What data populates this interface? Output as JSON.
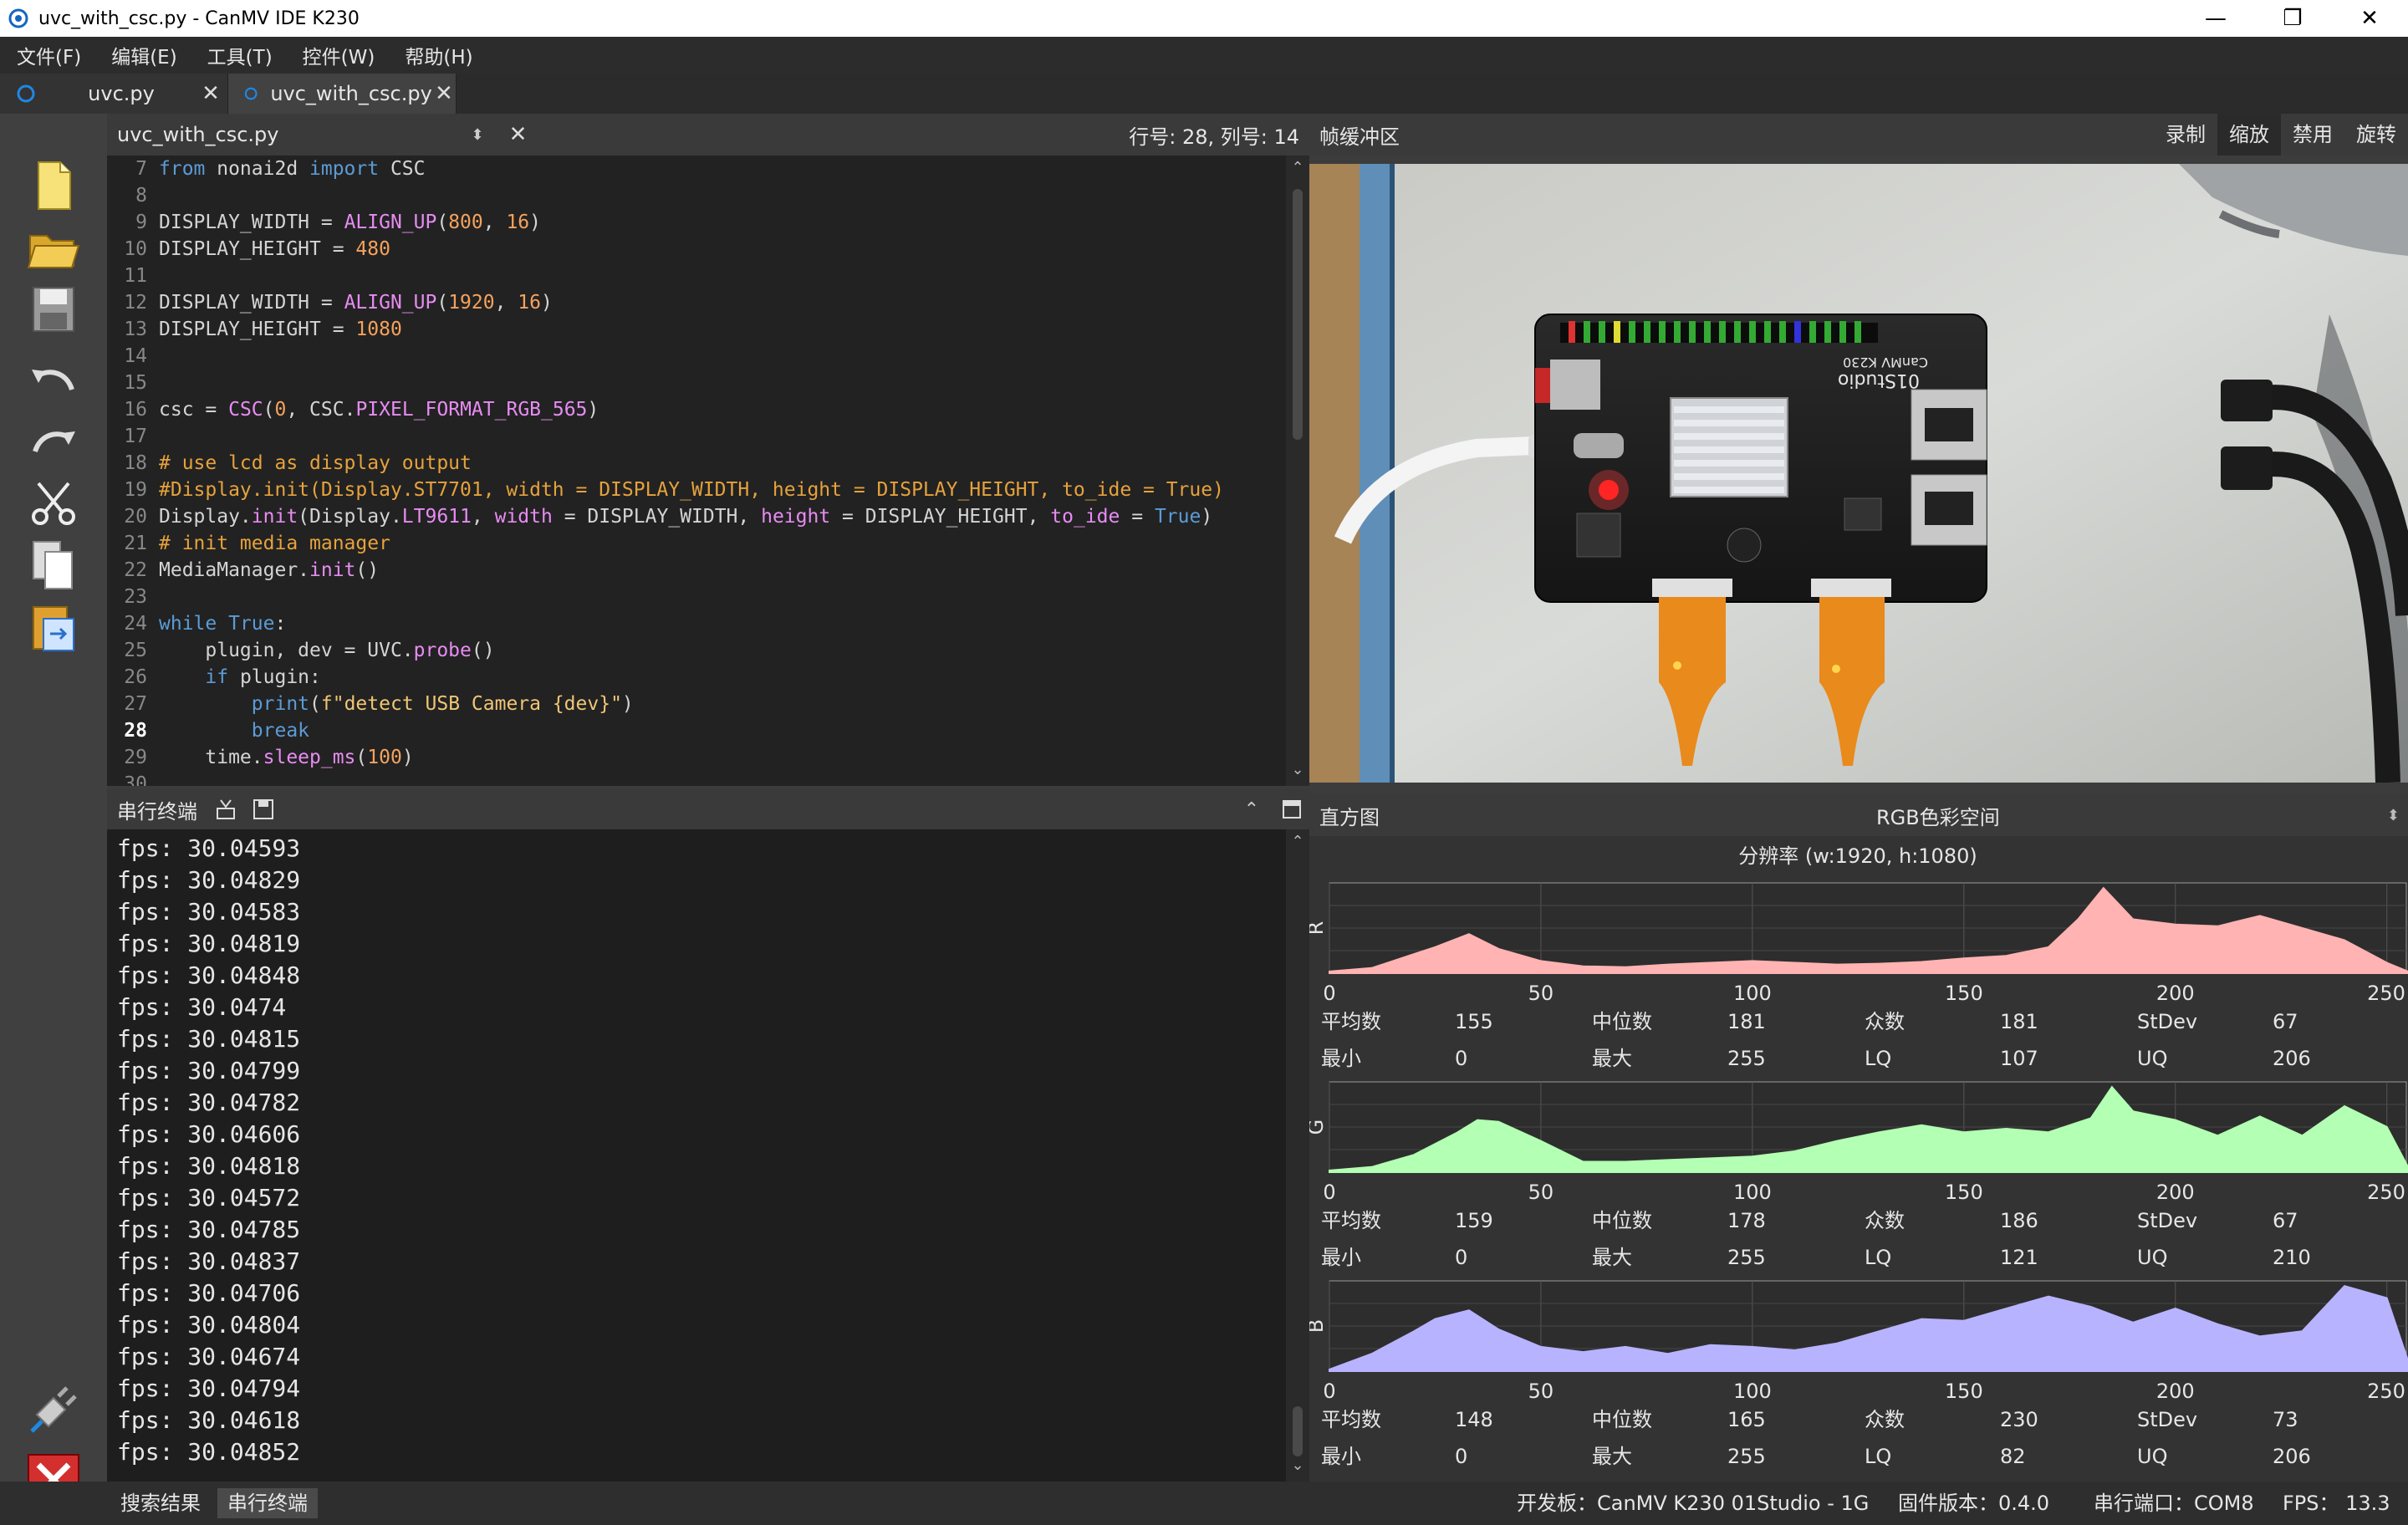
{
  "window": {
    "title": "uvc_with_csc.py - CanMV IDE K230",
    "minimize": "—",
    "restore": "❐",
    "close": "✕"
  },
  "menu": [
    "文件(F)",
    "编辑(E)",
    "工具(T)",
    "控件(W)",
    "帮助(H)"
  ],
  "tabs": [
    {
      "label": "uvc.py",
      "close": "✕"
    },
    {
      "label": "uvc_with_csc.py",
      "close": "✕"
    }
  ],
  "editor": {
    "file_name": "uvc_with_csc.py",
    "cursor_position": "行号: 28, 列号: 14",
    "current_line": "28",
    "lines": [
      {
        "n": "7"
      },
      {
        "n": "8"
      },
      {
        "n": "9"
      },
      {
        "n": "10"
      },
      {
        "n": "11"
      },
      {
        "n": "12"
      },
      {
        "n": "13"
      },
      {
        "n": "14"
      },
      {
        "n": "15"
      },
      {
        "n": "16"
      },
      {
        "n": "17"
      },
      {
        "n": "18"
      },
      {
        "n": "19"
      },
      {
        "n": "20"
      },
      {
        "n": "21"
      },
      {
        "n": "22"
      },
      {
        "n": "23"
      },
      {
        "n": "24"
      },
      {
        "n": "25"
      },
      {
        "n": "26"
      },
      {
        "n": "27"
      },
      {
        "n": "28"
      },
      {
        "n": "29"
      },
      {
        "n": "30"
      }
    ]
  },
  "framebuffer": {
    "title": "帧缓冲区",
    "buttons": [
      "录制",
      "缩放",
      "禁用",
      "旋转"
    ],
    "active_button": "缩放",
    "board_labels": {
      "brand": "01Studio",
      "model": "CanMV K230"
    }
  },
  "terminal": {
    "title": "串行终端",
    "lines": [
      "fps: 30.04593",
      "fps: 30.04829",
      "fps: 30.04583",
      "fps: 30.04819",
      "fps: 30.04848",
      "fps: 30.0474",
      "fps: 30.04815",
      "fps: 30.04799",
      "fps: 30.04782",
      "fps: 30.04606",
      "fps: 30.04818",
      "fps: 30.04572",
      "fps: 30.04785",
      "fps: 30.04837",
      "fps: 30.04706",
      "fps: 30.04804",
      "fps: 30.04674",
      "fps: 30.04794",
      "fps: 30.04618",
      "fps: 30.04852"
    ]
  },
  "histogram": {
    "title": "直方图",
    "color_space": "RGB色彩空间",
    "resolution": "分辨率 (w:1920, h:1080)",
    "labels": {
      "mean": "平均数",
      "median": "中位数",
      "mode": "众数",
      "stdev": "StDev",
      "min": "最小",
      "max": "最大",
      "lq": "LQ",
      "uq": "UQ"
    },
    "channels": [
      {
        "name": "R",
        "color": "#ffb3b3",
        "mean": "155",
        "median": "181",
        "mode": "181",
        "stdev": "67",
        "min": "0",
        "max": "255",
        "lq": "107",
        "uq": "206"
      },
      {
        "name": "G",
        "color": "#b3ffb3",
        "mean": "159",
        "median": "178",
        "mode": "186",
        "stdev": "67",
        "min": "0",
        "max": "255",
        "lq": "121",
        "uq": "210"
      },
      {
        "name": "B",
        "color": "#b8b3ff",
        "mean": "148",
        "median": "165",
        "mode": "230",
        "stdev": "73",
        "min": "0",
        "max": "255",
        "lq": "82",
        "uq": "206"
      }
    ]
  },
  "chart_data": [
    {
      "type": "area",
      "channel": "R",
      "x": [
        0,
        10,
        20,
        25,
        33,
        40,
        50,
        60,
        70,
        80,
        90,
        100,
        110,
        120,
        130,
        140,
        150,
        160,
        170,
        177,
        183,
        190,
        200,
        210,
        220,
        230,
        240,
        250,
        255
      ],
      "values": [
        0.02,
        0.06,
        0.22,
        0.3,
        0.45,
        0.28,
        0.14,
        0.08,
        0.07,
        0.1,
        0.12,
        0.14,
        0.12,
        0.1,
        0.11,
        0.13,
        0.17,
        0.2,
        0.3,
        0.62,
        0.98,
        0.62,
        0.56,
        0.54,
        0.66,
        0.52,
        0.38,
        0.12,
        0.02
      ],
      "xlim": [
        0,
        255
      ]
    },
    {
      "type": "area",
      "channel": "G",
      "x": [
        0,
        10,
        20,
        30,
        35,
        40,
        50,
        60,
        70,
        80,
        90,
        100,
        110,
        120,
        130,
        140,
        150,
        160,
        170,
        180,
        185,
        190,
        200,
        210,
        220,
        230,
        240,
        250,
        255
      ],
      "values": [
        0.02,
        0.06,
        0.2,
        0.45,
        0.6,
        0.58,
        0.36,
        0.12,
        0.12,
        0.14,
        0.16,
        0.18,
        0.24,
        0.36,
        0.46,
        0.54,
        0.46,
        0.5,
        0.46,
        0.62,
        0.98,
        0.7,
        0.6,
        0.42,
        0.64,
        0.42,
        0.76,
        0.52,
        0.06
      ],
      "xlim": [
        0,
        255
      ]
    },
    {
      "type": "area",
      "channel": "B",
      "x": [
        0,
        10,
        20,
        25,
        33,
        40,
        50,
        60,
        70,
        80,
        90,
        100,
        110,
        120,
        130,
        140,
        150,
        160,
        170,
        180,
        190,
        200,
        210,
        220,
        230,
        240,
        250,
        255
      ],
      "values": [
        0.02,
        0.2,
        0.46,
        0.6,
        0.7,
        0.48,
        0.28,
        0.22,
        0.28,
        0.2,
        0.3,
        0.28,
        0.24,
        0.32,
        0.46,
        0.6,
        0.58,
        0.72,
        0.86,
        0.74,
        0.56,
        0.72,
        0.54,
        0.4,
        0.46,
        0.98,
        0.84,
        0.12
      ],
      "xlim": [
        0,
        255
      ]
    }
  ],
  "histogram_ticks": [
    "0",
    "50",
    "100",
    "150",
    "200",
    "250"
  ],
  "status": {
    "tab_search": "搜索结果",
    "tab_serial": "串行终端",
    "board": "开发板：CanMV K230 01Studio - 1G",
    "firmware": "固件版本：0.4.0",
    "port": "串行端口：COM8",
    "fps": "FPS：  13.3"
  }
}
